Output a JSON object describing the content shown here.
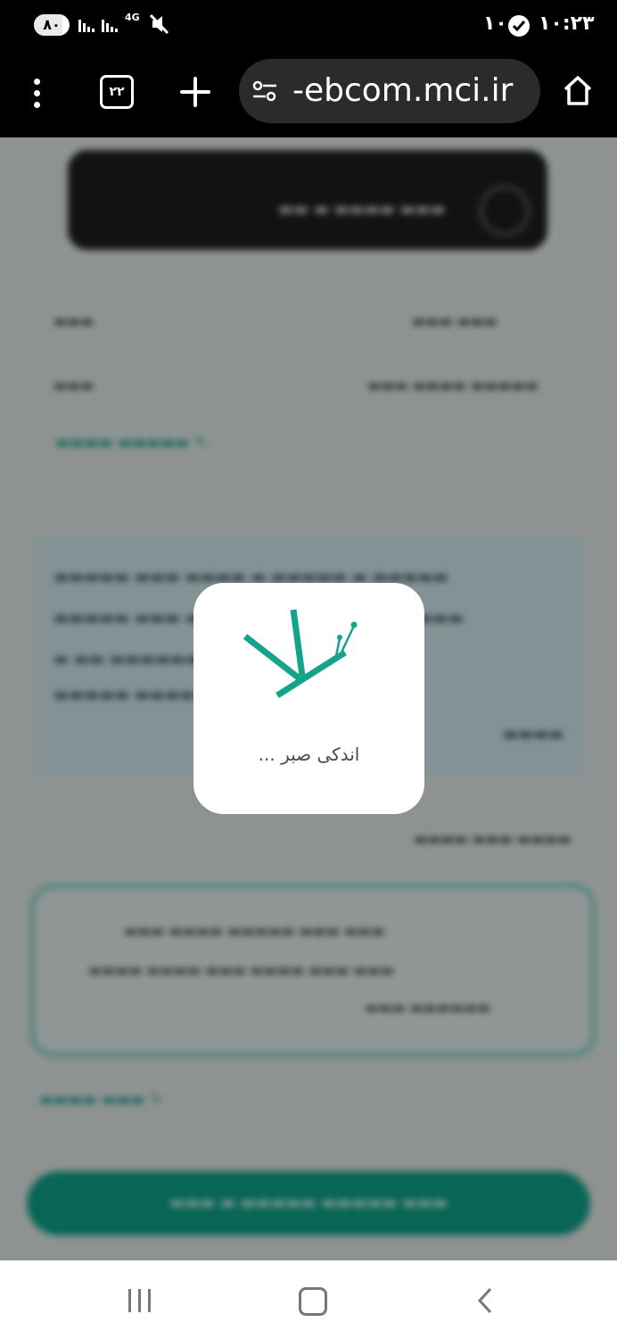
{
  "status_bar": {
    "battery": "۸۰",
    "battery_level": 0.8,
    "network": "4G",
    "notification_count": "۱۰",
    "time": "۱۰:۲۳"
  },
  "browser": {
    "tab_count": "۲۲",
    "url": "-ebcom.mci.ir"
  },
  "loader": {
    "message": "اندکی صبر ..."
  },
  "icons": {
    "menu": "more-vert-icon",
    "tabs": "tab-switcher-icon",
    "new_tab": "plus-icon",
    "site_settings": "tune-icon",
    "home": "home-icon",
    "nav_recent": "recent-apps-icon",
    "nav_home": "nav-home-icon",
    "nav_back": "back-icon"
  },
  "colors": {
    "brand_green": "#14a38b",
    "toolbar_bg": "#000000",
    "dialog_bg": "#ffffff"
  }
}
